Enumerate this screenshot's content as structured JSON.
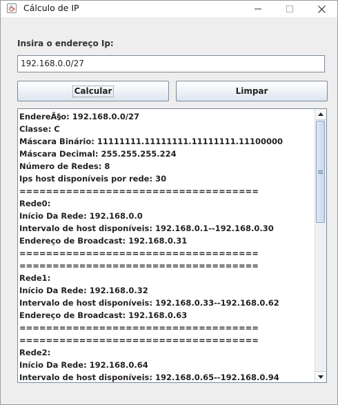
{
  "window": {
    "title": "Cálculo de IP"
  },
  "form": {
    "label": "Insira o endereço Ip:",
    "ip_value": "192.168.0.0/27",
    "calc_label": "Calcular",
    "clear_label": "Limpar"
  },
  "output": {
    "lines": [
      "EndereÃ§o: 192.168.0.0/27",
      "Classe: C",
      "Máscara Binário: 11111111.11111111.11111111.11100000",
      "Máscara Decimal: 255.255.255.224",
      "Número de Redes: 8",
      "Ips host disponíveis por rede: 30",
      "====================================",
      "Rede0:",
      "Início Da Rede: 192.168.0.0",
      "Intervalo de host disponíveis: 192.168.0.1--192.168.0.30",
      "Endereço de Broadcast: 192.168.0.31",
      "====================================",
      "====================================",
      "Rede1:",
      "Início Da Rede: 192.168.0.32",
      "Intervalo de host disponíveis: 192.168.0.33--192.168.0.62",
      "Endereço de Broadcast: 192.168.0.63",
      "====================================",
      "====================================",
      "Rede2:",
      "Início Da Rede: 192.168.0.64",
      "Intervalo de host disponíveis: 192.168.0.65--192.168.0.94"
    ]
  },
  "icons": {
    "app": "java-cup-icon",
    "minimize": "minimize-icon",
    "maximize": "maximize-icon",
    "close": "close-icon",
    "scroll_up": "arrow-up-icon",
    "scroll_down": "arrow-down-icon",
    "scroll_grip": "grip-icon"
  }
}
